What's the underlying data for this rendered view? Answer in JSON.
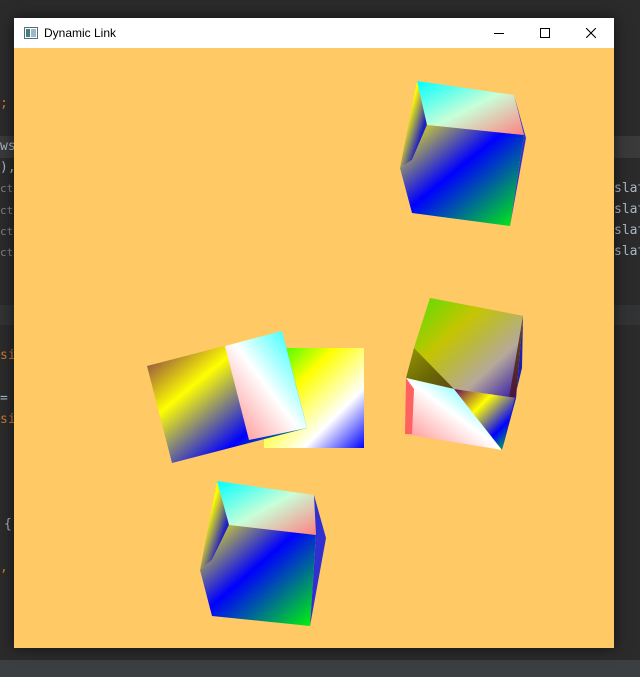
{
  "window": {
    "title": "Dynamic Link",
    "background_color": "#ffc966",
    "controls": {
      "minimize": "minimize-icon",
      "maximize": "maximize-icon",
      "close": "close-icon"
    }
  },
  "canvas": {
    "description_objects": [
      "cube-top-right",
      "cube-middle-right",
      "cube-center-left",
      "quad-center",
      "cube-bottom"
    ]
  },
  "background_editor": {
    "left_fragments": [
      ";",
      "ws",
      "),",
      "cto",
      "cto",
      "cto",
      "cto",
      "si",
      "=",
      "si",
      "{",
      ","
    ],
    "right_fragments": [
      "slat",
      "slat",
      "slat",
      "slat"
    ]
  }
}
